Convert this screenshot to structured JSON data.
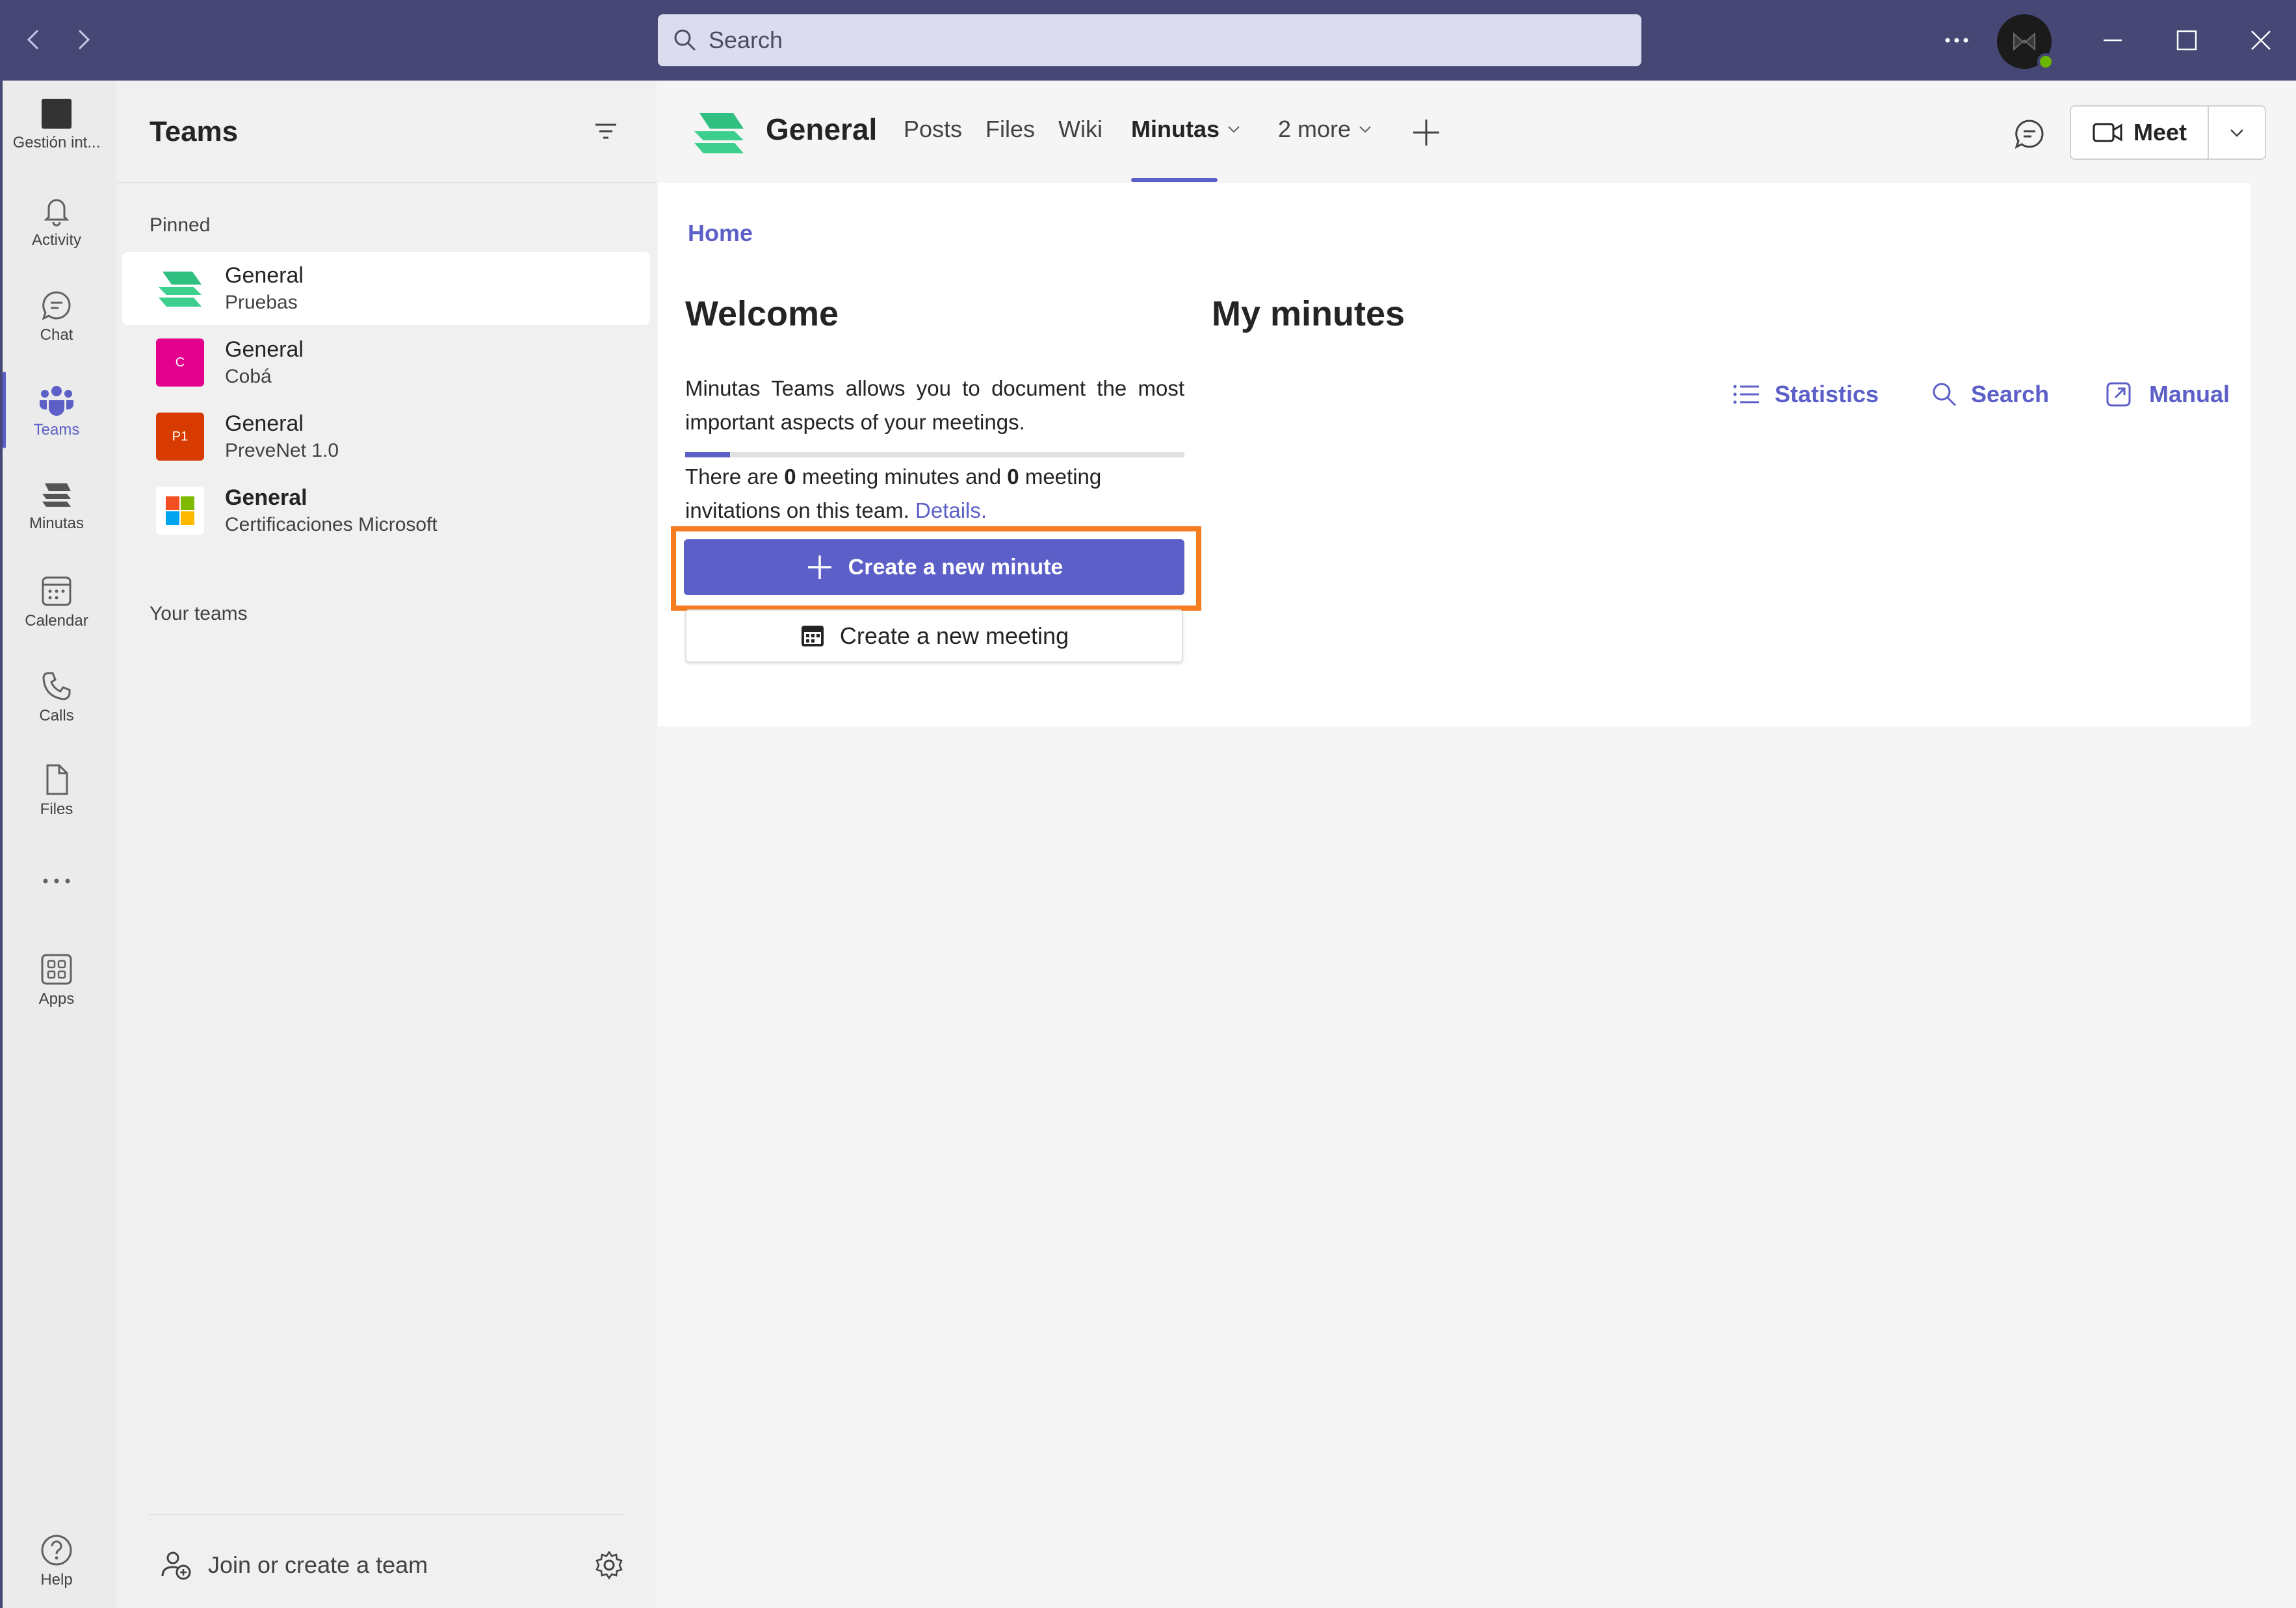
{
  "titlebar": {
    "search_placeholder": "Search",
    "more_icon": "more-horizontal-icon",
    "back_icon": "chevron-left-icon",
    "forward_icon": "chevron-right-icon"
  },
  "rail": {
    "items": [
      {
        "label": "Gestión int...",
        "icon": "app-tile-icon"
      },
      {
        "label": "Activity",
        "icon": "bell-icon"
      },
      {
        "label": "Chat",
        "icon": "chat-icon"
      },
      {
        "label": "Teams",
        "icon": "teams-icon"
      },
      {
        "label": "Minutas",
        "icon": "minutas-icon"
      },
      {
        "label": "Calendar",
        "icon": "calendar-icon"
      },
      {
        "label": "Calls",
        "icon": "phone-icon"
      },
      {
        "label": "Files",
        "icon": "file-icon"
      },
      {
        "label": "Apps",
        "icon": "apps-icon"
      },
      {
        "label": "Help",
        "icon": "help-icon"
      }
    ]
  },
  "teamlist": {
    "title": "Teams",
    "pinned_label": "Pinned",
    "your_teams_label": "Your teams",
    "pinned": [
      {
        "name": "General",
        "team": "Pruebas",
        "tile_text": ""
      },
      {
        "name": "General",
        "team": "Cobá",
        "tile_text": "C"
      },
      {
        "name": "General",
        "team": "PreveNet 1.0",
        "tile_text": "P1"
      },
      {
        "name": "General",
        "team": "Certificaciones Microsoft",
        "tile_text": ""
      }
    ],
    "join_label": "Join or create a team"
  },
  "channel": {
    "name": "General",
    "tabs": [
      "Posts",
      "Files",
      "Wiki",
      "Minutas",
      "2 more"
    ],
    "meet_label": "Meet"
  },
  "content": {
    "breadcrumb": "Home",
    "welcome_title": "Welcome",
    "welcome_text": "Minutas Teams allows you to document the most important aspects of your meetings.",
    "progress_percent": 9,
    "stats": {
      "prefix": "There are ",
      "minutes_count": "0",
      "middle": " meeting minutes and ",
      "invitations_count": "0",
      "suffix": " meeting invitations on this team. ",
      "details_link": "Details."
    },
    "create_minute_label": "Create a new minute",
    "create_meeting_label": "Create a new meeting",
    "my_minutes_title": "My minutes",
    "actions": [
      {
        "label": "Statistics",
        "icon": "list-icon"
      },
      {
        "label": "Search",
        "icon": "search-icon"
      },
      {
        "label": "Manual",
        "icon": "open-external-icon"
      }
    ]
  },
  "colors": {
    "titlebar": "#464775",
    "accent": "#5b5fc7",
    "highlight": "#f57c20"
  }
}
